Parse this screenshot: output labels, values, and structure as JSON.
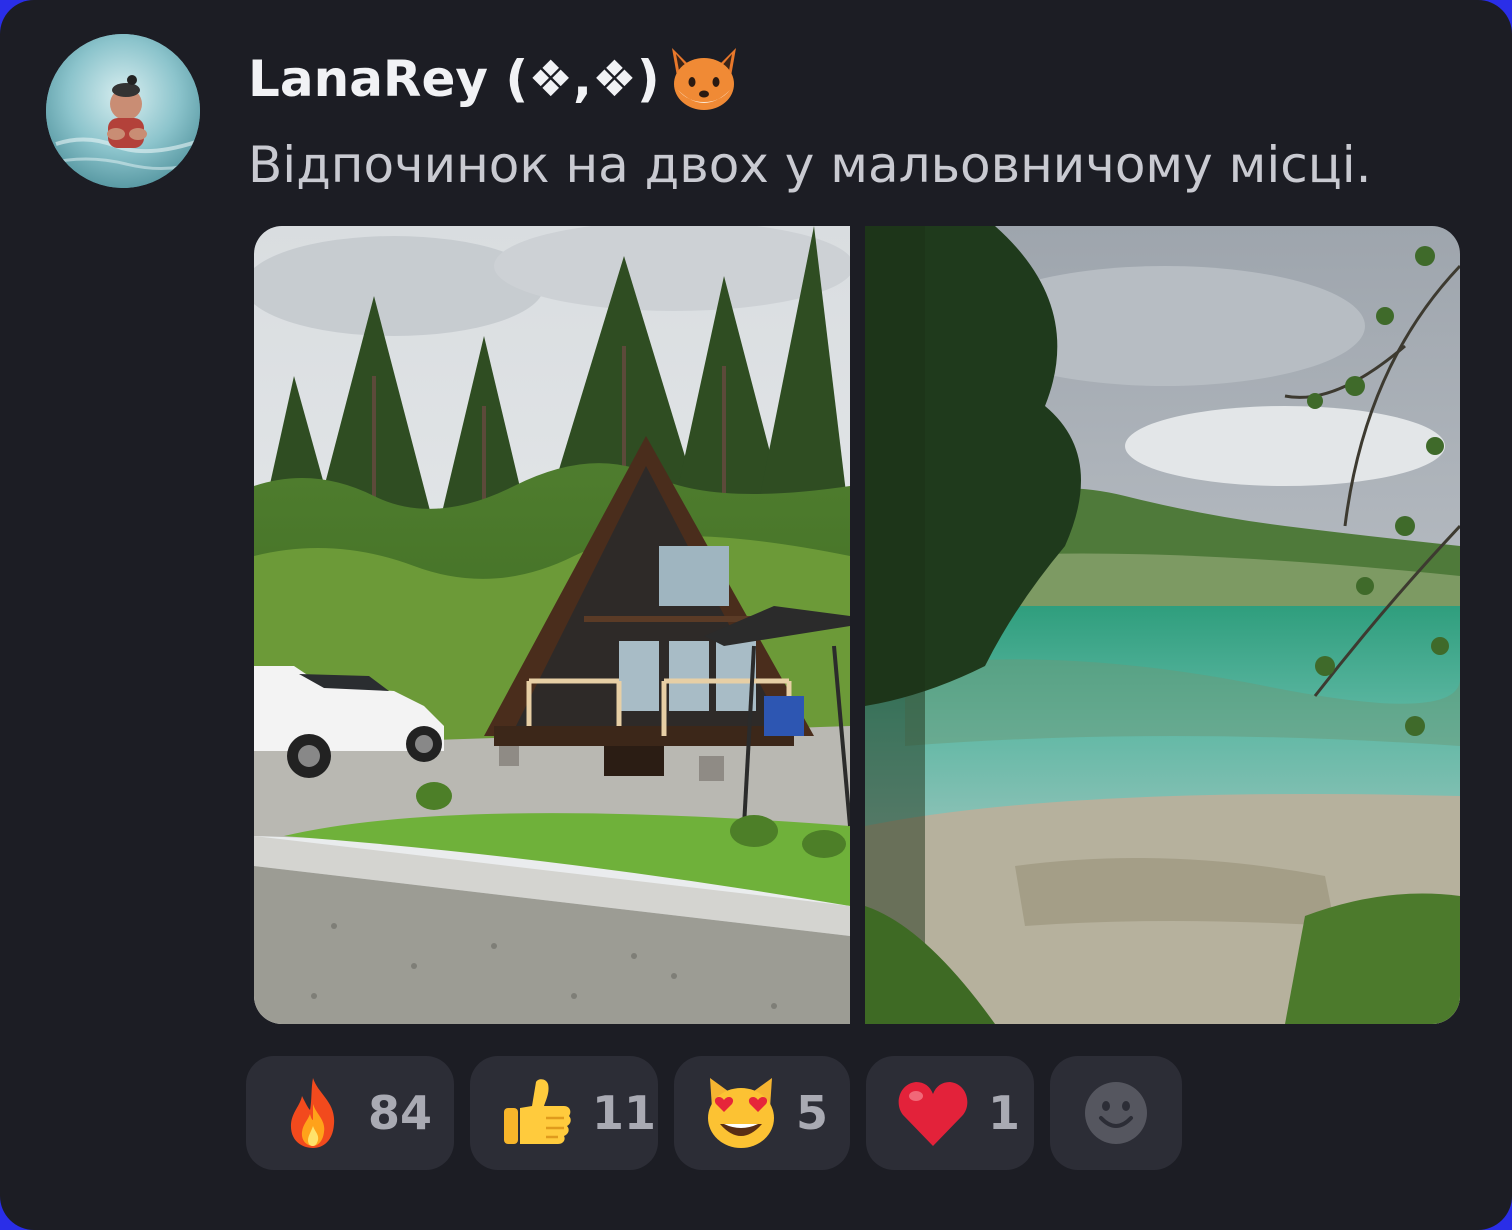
{
  "post": {
    "author": "LanaRey (❖,❖)",
    "author_emoji_icon": "fox-face-icon",
    "text": "Відпочинок на двох у мальовничому місці."
  },
  "photos": [
    {
      "icon": "a-frame-cabin-photo"
    },
    {
      "icon": "turquoise-lake-photo"
    }
  ],
  "reactions": [
    {
      "icon": "fire-emoji",
      "count": "84"
    },
    {
      "icon": "thumbs-up-emoji",
      "count": "11"
    },
    {
      "icon": "heart-eyes-cat-emoji",
      "count": "5"
    },
    {
      "icon": "red-heart-emoji",
      "count": "1"
    }
  ],
  "add_reaction_icon": "smiley-add-reaction-icon",
  "colors": {
    "card_bg": "#1c1d24",
    "reaction_bg": "#2c2d36",
    "outer_bg": "#2a2ee8"
  }
}
